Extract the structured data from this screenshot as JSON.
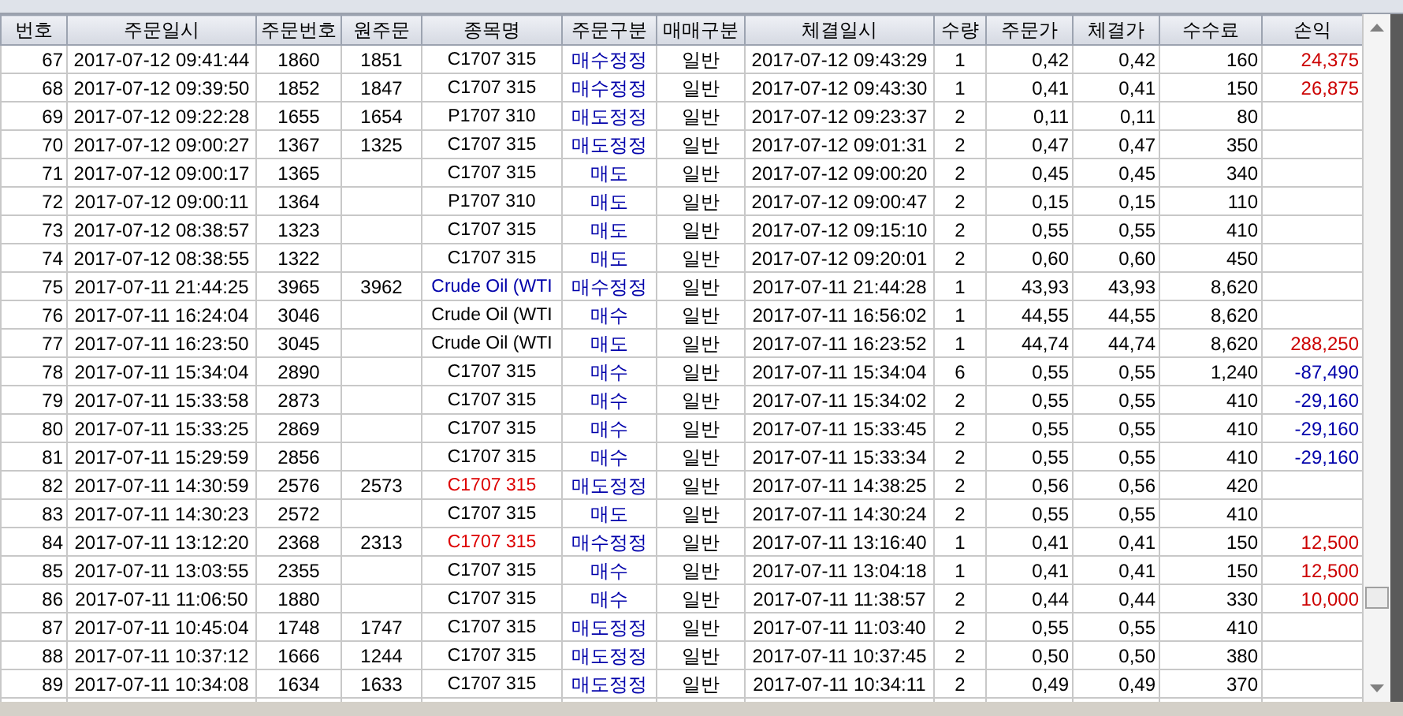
{
  "table": {
    "columns": [
      "번호",
      "주문일시",
      "주문번호",
      "원주문",
      "종목명",
      "주문구분",
      "매매구분",
      "체결일시",
      "수량",
      "주문가",
      "체결가",
      "수수료",
      "손익"
    ],
    "rows": [
      {
        "no": "67",
        "order_time": "2017-07-12 09:41:44",
        "order_no": "1860",
        "original_order": "1851",
        "symbol": {
          "text": "C1707 315",
          "color": "#000000"
        },
        "order_type": "매수정정",
        "trade_type": "일반",
        "fill_time": "2017-07-12 09:43:29",
        "qty": "1",
        "order_price": "0,42",
        "fill_price": "0,42",
        "fee": "160",
        "pnl": {
          "text": "24,375",
          "color": "#cc0000"
        }
      },
      {
        "no": "68",
        "order_time": "2017-07-12 09:39:50",
        "order_no": "1852",
        "original_order": "1847",
        "symbol": {
          "text": "C1707 315",
          "color": "#000000"
        },
        "order_type": "매수정정",
        "trade_type": "일반",
        "fill_time": "2017-07-12 09:43:30",
        "qty": "1",
        "order_price": "0,41",
        "fill_price": "0,41",
        "fee": "150",
        "pnl": {
          "text": "26,875",
          "color": "#cc0000"
        }
      },
      {
        "no": "69",
        "order_time": "2017-07-12 09:22:28",
        "order_no": "1655",
        "original_order": "1654",
        "symbol": {
          "text": "P1707 310",
          "color": "#000000"
        },
        "order_type": "매도정정",
        "trade_type": "일반",
        "fill_time": "2017-07-12 09:23:37",
        "qty": "2",
        "order_price": "0,11",
        "fill_price": "0,11",
        "fee": "80"
      },
      {
        "no": "70",
        "order_time": "2017-07-12 09:00:27",
        "order_no": "1367",
        "original_order": "1325",
        "symbol": {
          "text": "C1707 315",
          "color": "#000000"
        },
        "order_type": "매도정정",
        "trade_type": "일반",
        "fill_time": "2017-07-12 09:01:31",
        "qty": "2",
        "order_price": "0,47",
        "fill_price": "0,47",
        "fee": "350"
      },
      {
        "no": "71",
        "order_time": "2017-07-12 09:00:17",
        "order_no": "1365",
        "symbol": {
          "text": "C1707 315",
          "color": "#000000"
        },
        "order_type": "매도",
        "trade_type": "일반",
        "fill_time": "2017-07-12 09:00:20",
        "qty": "2",
        "order_price": "0,45",
        "fill_price": "0,45",
        "fee": "340"
      },
      {
        "no": "72",
        "order_time": "2017-07-12 09:00:11",
        "order_no": "1364",
        "symbol": {
          "text": "P1707 310",
          "color": "#000000"
        },
        "order_type": "매도",
        "trade_type": "일반",
        "fill_time": "2017-07-12 09:00:47",
        "qty": "2",
        "order_price": "0,15",
        "fill_price": "0,15",
        "fee": "110"
      },
      {
        "no": "73",
        "order_time": "2017-07-12 08:38:57",
        "order_no": "1323",
        "symbol": {
          "text": "C1707 315",
          "color": "#000000"
        },
        "order_type": "매도",
        "trade_type": "일반",
        "fill_time": "2017-07-12 09:15:10",
        "qty": "2",
        "order_price": "0,55",
        "fill_price": "0,55",
        "fee": "410"
      },
      {
        "no": "74",
        "order_time": "2017-07-12 08:38:55",
        "order_no": "1322",
        "symbol": {
          "text": "C1707 315",
          "color": "#000000"
        },
        "order_type": "매도",
        "trade_type": "일반",
        "fill_time": "2017-07-12 09:20:01",
        "qty": "2",
        "order_price": "0,60",
        "fill_price": "0,60",
        "fee": "450"
      },
      {
        "no": "75",
        "order_time": "2017-07-11 21:44:25",
        "order_no": "3965",
        "original_order": "3962",
        "symbol": {
          "text": "Crude Oil (WTI",
          "color": "#0000aa"
        },
        "order_type": "매수정정",
        "trade_type": "일반",
        "fill_time": "2017-07-11 21:44:28",
        "qty": "1",
        "order_price": "43,93",
        "fill_price": "43,93",
        "fee": "8,620"
      },
      {
        "no": "76",
        "order_time": "2017-07-11 16:24:04",
        "order_no": "3046",
        "symbol": {
          "text": "Crude Oil (WTI",
          "color": "#000000"
        },
        "order_type": "매수",
        "trade_type": "일반",
        "fill_time": "2017-07-11 16:56:02",
        "qty": "1",
        "order_price": "44,55",
        "fill_price": "44,55",
        "fee": "8,620"
      },
      {
        "no": "77",
        "order_time": "2017-07-11 16:23:50",
        "order_no": "3045",
        "symbol": {
          "text": "Crude Oil (WTI",
          "color": "#000000"
        },
        "order_type": "매도",
        "trade_type": "일반",
        "fill_time": "2017-07-11 16:23:52",
        "qty": "1",
        "order_price": "44,74",
        "fill_price": "44,74",
        "fee": "8,620",
        "pnl": {
          "text": "288,250",
          "color": "#cc0000"
        }
      },
      {
        "no": "78",
        "order_time": "2017-07-11 15:34:04",
        "order_no": "2890",
        "symbol": {
          "text": "C1707 315",
          "color": "#000000"
        },
        "order_type": "매수",
        "trade_type": "일반",
        "fill_time": "2017-07-11 15:34:04",
        "qty": "6",
        "order_price": "0,55",
        "fill_price": "0,55",
        "fee": "1,240",
        "pnl": {
          "text": "-87,490",
          "color": "#0000aa"
        }
      },
      {
        "no": "79",
        "order_time": "2017-07-11 15:33:58",
        "order_no": "2873",
        "symbol": {
          "text": "C1707 315",
          "color": "#000000"
        },
        "order_type": "매수",
        "trade_type": "일반",
        "fill_time": "2017-07-11 15:34:02",
        "qty": "2",
        "order_price": "0,55",
        "fill_price": "0,55",
        "fee": "410",
        "pnl": {
          "text": "-29,160",
          "color": "#0000aa"
        }
      },
      {
        "no": "80",
        "order_time": "2017-07-11 15:33:25",
        "order_no": "2869",
        "symbol": {
          "text": "C1707 315",
          "color": "#000000"
        },
        "order_type": "매수",
        "trade_type": "일반",
        "fill_time": "2017-07-11 15:33:45",
        "qty": "2",
        "order_price": "0,55",
        "fill_price": "0,55",
        "fee": "410",
        "pnl": {
          "text": "-29,160",
          "color": "#0000aa"
        }
      },
      {
        "no": "81",
        "order_time": "2017-07-11 15:29:59",
        "order_no": "2856",
        "symbol": {
          "text": "C1707 315",
          "color": "#000000"
        },
        "order_type": "매수",
        "trade_type": "일반",
        "fill_time": "2017-07-11 15:33:34",
        "qty": "2",
        "order_price": "0,55",
        "fill_price": "0,55",
        "fee": "410",
        "pnl": {
          "text": "-29,160",
          "color": "#0000aa"
        }
      },
      {
        "no": "82",
        "order_time": "2017-07-11 14:30:59",
        "order_no": "2576",
        "original_order": "2573",
        "symbol": {
          "text": "C1707 315",
          "color": "#dd0000"
        },
        "order_type": "매도정정",
        "trade_type": "일반",
        "fill_time": "2017-07-11 14:38:25",
        "qty": "2",
        "order_price": "0,56",
        "fill_price": "0,56",
        "fee": "420"
      },
      {
        "no": "83",
        "order_time": "2017-07-11 14:30:23",
        "order_no": "2572",
        "symbol": {
          "text": "C1707 315",
          "color": "#000000"
        },
        "order_type": "매도",
        "trade_type": "일반",
        "fill_time": "2017-07-11 14:30:24",
        "qty": "2",
        "order_price": "0,55",
        "fill_price": "0,55",
        "fee": "410"
      },
      {
        "no": "84",
        "order_time": "2017-07-11 13:12:20",
        "order_no": "2368",
        "original_order": "2313",
        "symbol": {
          "text": "C1707 315",
          "color": "#dd0000"
        },
        "order_type": "매수정정",
        "trade_type": "일반",
        "fill_time": "2017-07-11 13:16:40",
        "qty": "1",
        "order_price": "0,41",
        "fill_price": "0,41",
        "fee": "150",
        "pnl": {
          "text": "12,500",
          "color": "#cc0000"
        }
      },
      {
        "no": "85",
        "order_time": "2017-07-11 13:03:55",
        "order_no": "2355",
        "symbol": {
          "text": "C1707 315",
          "color": "#000000"
        },
        "order_type": "매수",
        "trade_type": "일반",
        "fill_time": "2017-07-11 13:04:18",
        "qty": "1",
        "order_price": "0,41",
        "fill_price": "0,41",
        "fee": "150",
        "pnl": {
          "text": "12,500",
          "color": "#cc0000"
        }
      },
      {
        "no": "86",
        "order_time": "2017-07-11 11:06:50",
        "order_no": "1880",
        "symbol": {
          "text": "C1707 315",
          "color": "#000000"
        },
        "order_type": "매수",
        "trade_type": "일반",
        "fill_time": "2017-07-11 11:38:57",
        "qty": "2",
        "order_price": "0,44",
        "fill_price": "0,44",
        "fee": "330",
        "pnl": {
          "text": "10,000",
          "color": "#cc0000"
        }
      },
      {
        "no": "87",
        "order_time": "2017-07-11 10:45:04",
        "order_no": "1748",
        "original_order": "1747",
        "symbol": {
          "text": "C1707 315",
          "color": "#000000"
        },
        "order_type": "매도정정",
        "trade_type": "일반",
        "fill_time": "2017-07-11 11:03:40",
        "qty": "2",
        "order_price": "0,55",
        "fill_price": "0,55",
        "fee": "410"
      },
      {
        "no": "88",
        "order_time": "2017-07-11 10:37:12",
        "order_no": "1666",
        "original_order": "1244",
        "symbol": {
          "text": "C1707 315",
          "color": "#000000"
        },
        "order_type": "매도정정",
        "trade_type": "일반",
        "fill_time": "2017-07-11 10:37:45",
        "qty": "2",
        "order_price": "0,50",
        "fill_price": "0,50",
        "fee": "380"
      },
      {
        "no": "89",
        "order_time": "2017-07-11 10:34:08",
        "order_no": "1634",
        "original_order": "1633",
        "symbol": {
          "text": "C1707 315",
          "color": "#000000"
        },
        "order_type": "매도정정",
        "trade_type": "일반",
        "fill_time": "2017-07-11 10:34:11",
        "qty": "2",
        "order_price": "0,49",
        "fill_price": "0,49",
        "fee": "370"
      }
    ]
  }
}
